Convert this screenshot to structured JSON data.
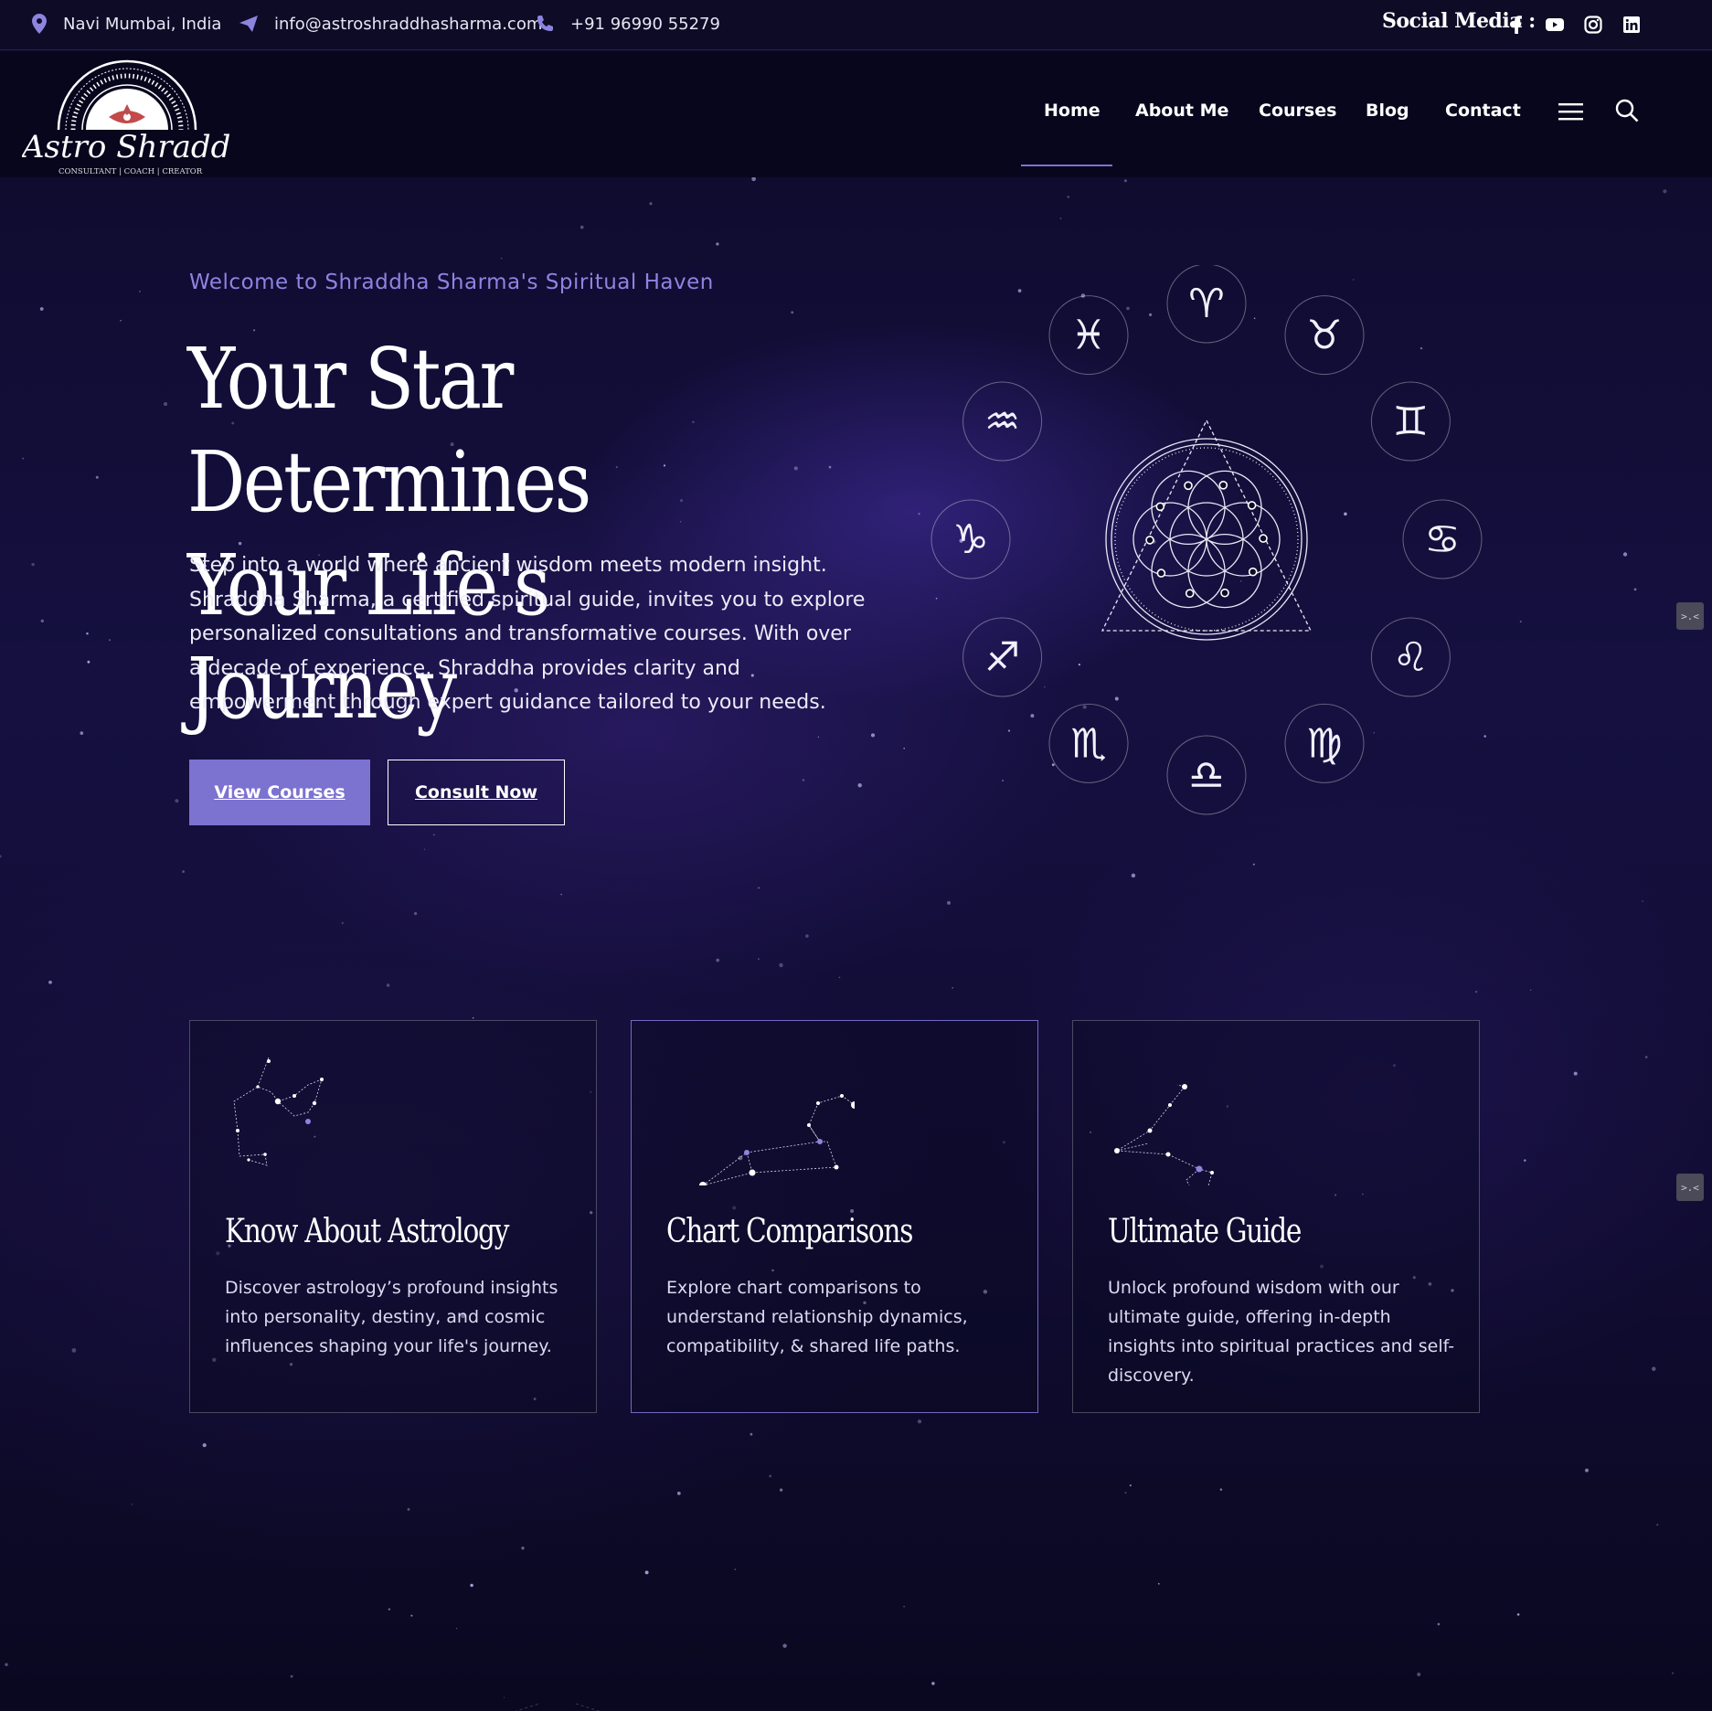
{
  "topbar": {
    "location": "Navi Mumbai, India",
    "email": "info@astroshraddhasharma.com",
    "phone": "+91 96990 55279",
    "social_label": "Social Media :",
    "social_icons": [
      "facebook-icon",
      "youtube-icon",
      "instagram-icon",
      "linkedin-icon"
    ]
  },
  "brand": {
    "name": "Astro Shraddha",
    "tagline": "CONSULTANT | COACH | CREATOR"
  },
  "nav": {
    "items": [
      "Home",
      "About Me",
      "Courses",
      "Blog",
      "Contact"
    ],
    "active": "Home"
  },
  "hero": {
    "welcome": "Welcome to Shraddha Sharma's Spiritual Haven",
    "title_line1": "Your Star Determines",
    "title_line2": "Your Life's Journey",
    "text": "Step into a world where ancient wisdom meets modern insight. Shraddha Sharma, a certified spiritual guide, invites you to explore personalized consultations and transformative courses. With over a decade of experience, Shraddha provides clarity and empowerment through expert guidance tailored to your needs.",
    "btn_primary": "View Courses",
    "btn_secondary": "Consult Now"
  },
  "zodiac": [
    "♈",
    "♉",
    "♊",
    "♋",
    "♌",
    "♍",
    "♎",
    "♏",
    "♐",
    "♑",
    "♒",
    "♓"
  ],
  "cards": [
    {
      "title": "Know About Astrology",
      "text": "Discover astrology’s profound insights into personality, destiny, and cosmic influences shaping your life's journey."
    },
    {
      "title": "Chart Comparisons",
      "text": "Explore chart comparisons to understand relationship dynamics, compatibility, & shared life paths."
    },
    {
      "title": "Ultimate Guide",
      "text": "Unlock profound wisdom with our ultimate guide, offering in-depth insights into spiritual practices and self-discovery."
    }
  ],
  "side_tabs": [
    ">.<",
    ">.<"
  ],
  "colors": {
    "accent": "#7c72d0",
    "welcome": "#8d84e0",
    "background": "#0a0820"
  }
}
